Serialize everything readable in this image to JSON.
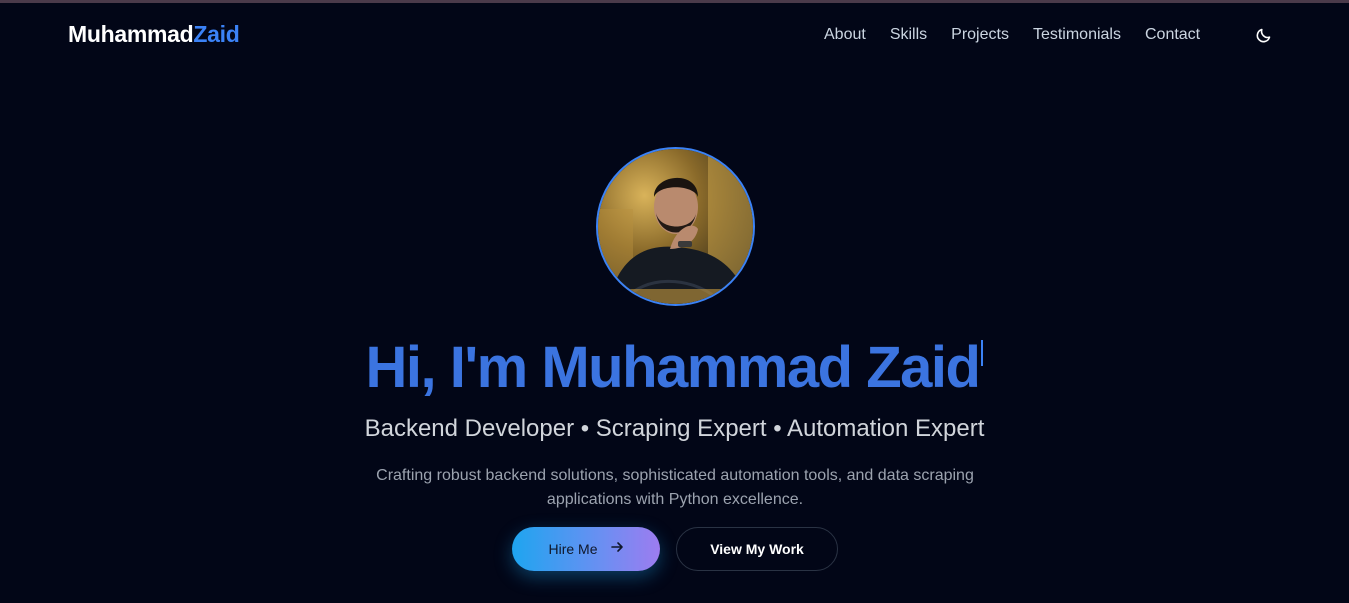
{
  "nav": {
    "logo_first": "Muhammad",
    "logo_second": "Zaid",
    "links": [
      "About",
      "Skills",
      "Projects",
      "Testimonials",
      "Contact"
    ],
    "theme_icon": "moon-icon"
  },
  "hero": {
    "avatar_alt": "profile-photo",
    "headline": "Hi, I'm Muhammad Zaid",
    "roles": "Backend Developer • Scraping Expert • Automation Expert",
    "description": "Crafting robust backend solutions, sophisticated automation tools, and data scraping applications with Python excellence.",
    "primary_button": "Hire Me",
    "secondary_button": "View My Work"
  },
  "colors": {
    "background": "#020617",
    "accent": "#3b82f6",
    "headline": "#3b74e0"
  }
}
